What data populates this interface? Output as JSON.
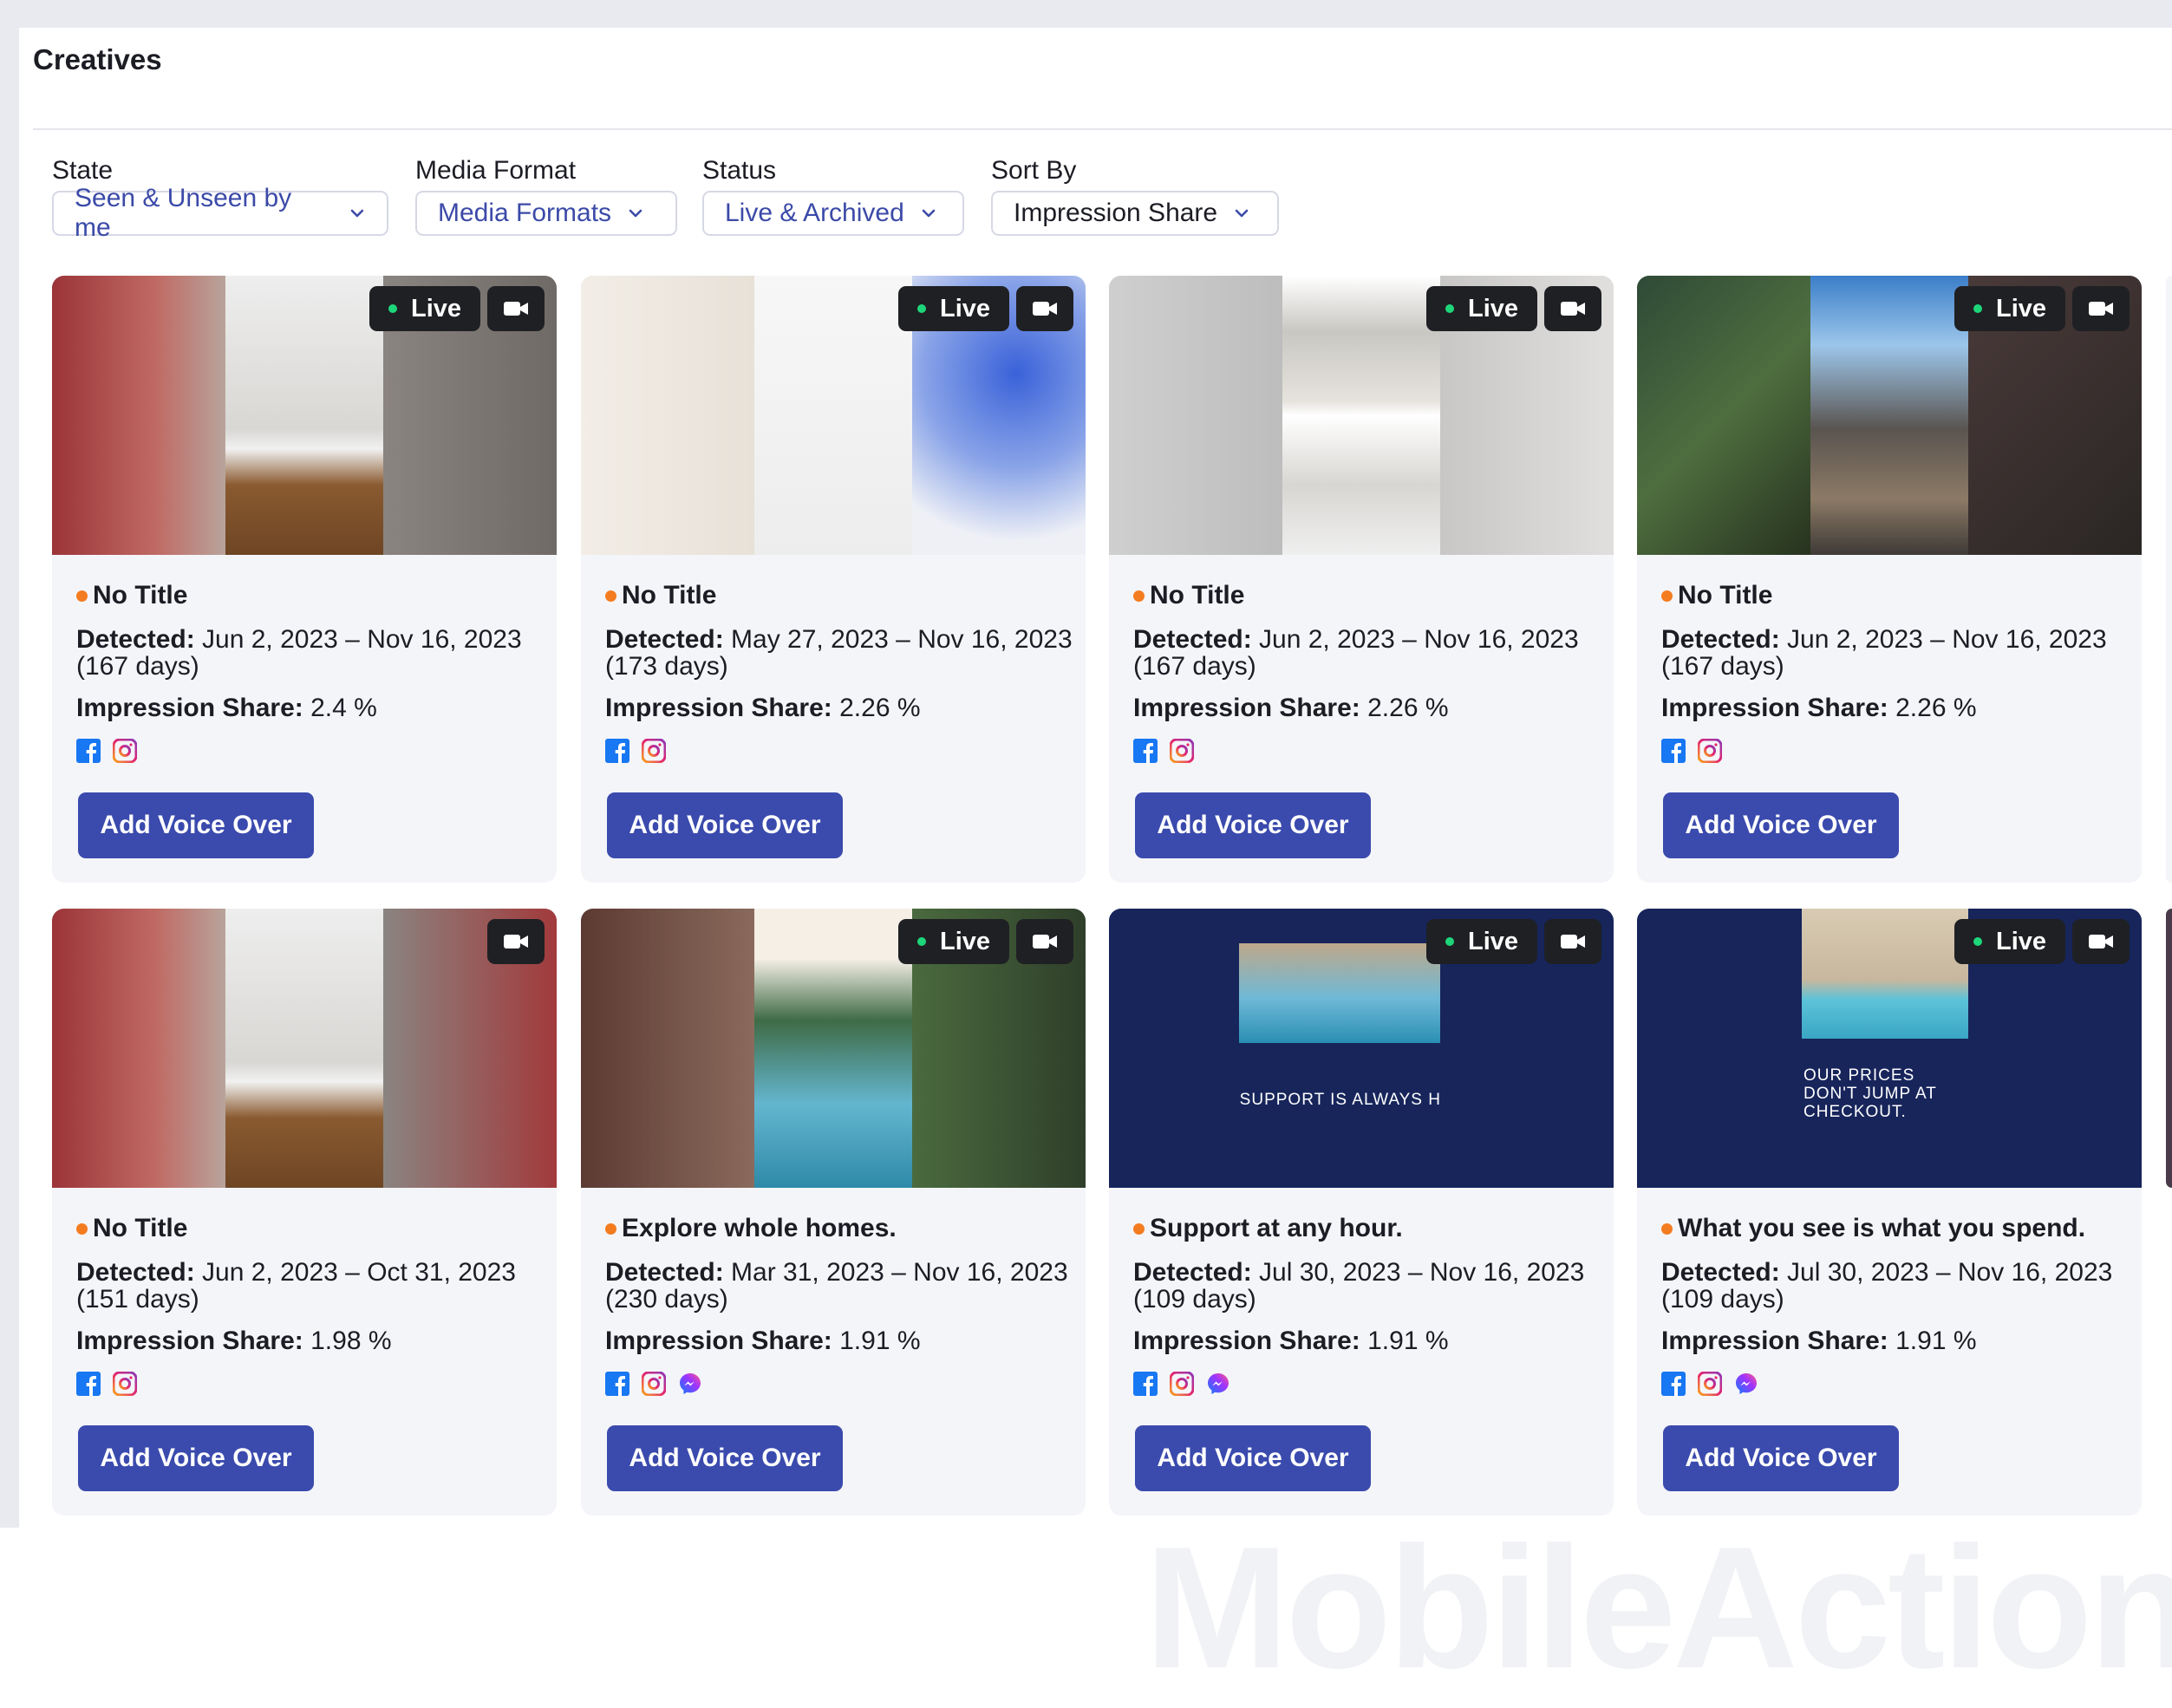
{
  "section": {
    "title": "Creatives"
  },
  "filters": [
    {
      "label": "State",
      "value": "Seen & Unseen by me"
    },
    {
      "label": "Media Format",
      "value": "Media Formats"
    },
    {
      "label": "Status",
      "value": "Live & Archived"
    },
    {
      "label": "Sort By",
      "value": "Impression Share"
    }
  ],
  "cards": [
    {
      "title": "No Title",
      "detected_label": "Detected:",
      "detected": "Jun 2, 2023 – Nov 16, 2023 (167 days)",
      "share_label": "Impression Share:",
      "share": "2.4 %",
      "live_label": "Live",
      "platforms": [
        "facebook-icon",
        "instagram-icon"
      ],
      "button": "Add Voice Over"
    },
    {
      "title": "No Title",
      "detected_label": "Detected:",
      "detected": "May 27, 2023 – Nov 16, 2023 (173 days)",
      "share_label": "Impression Share:",
      "share": "2.26 %",
      "live_label": "Live",
      "platforms": [
        "facebook-icon",
        "instagram-icon"
      ],
      "button": "Add Voice Over"
    },
    {
      "title": "No Title",
      "detected_label": "Detected:",
      "detected": "Jun 2, 2023 – Nov 16, 2023 (167 days)",
      "share_label": "Impression Share:",
      "share": "2.26 %",
      "live_label": "Live",
      "platforms": [
        "facebook-icon",
        "instagram-icon"
      ],
      "button": "Add Voice Over"
    },
    {
      "title": "No Title",
      "detected_label": "Detected:",
      "detected": "Jun 2, 2023 – Nov 16, 2023 (167 days)",
      "share_label": "Impression Share:",
      "share": "2.26 %",
      "live_label": "Live",
      "platforms": [
        "facebook-icon",
        "instagram-icon"
      ],
      "button": "Add Voice Over"
    },
    {
      "title": "No Title",
      "detected_label": "Detected:",
      "detected": "Jun 2, 2023 – Oct 31, 2023 (151 days)",
      "share_label": "Impression Share:",
      "share": "1.98 %",
      "live_label": "",
      "platforms": [
        "facebook-icon",
        "instagram-icon"
      ],
      "button": "Add Voice Over"
    },
    {
      "title": "Explore whole homes.",
      "detected_label": "Detected:",
      "detected": "Mar 31, 2023 – Nov 16, 2023 (230 days)",
      "share_label": "Impression Share:",
      "share": "1.91 %",
      "live_label": "Live",
      "platforms": [
        "facebook-icon",
        "instagram-icon",
        "messenger-icon"
      ],
      "button": "Add Voice Over"
    },
    {
      "title": "Support at any hour.",
      "detected_label": "Detected:",
      "detected": "Jul 30, 2023 – Nov 16, 2023 (109 days)",
      "share_label": "Impression Share:",
      "share": "1.91 %",
      "live_label": "Live",
      "platforms": [
        "facebook-icon",
        "instagram-icon",
        "messenger-icon"
      ],
      "button": "Add Voice Over",
      "overlay_text": "SUPPORT IS ALWAYS HERE."
    },
    {
      "title": "What you see is what you spend.",
      "detected_label": "Detected:",
      "detected": "Jul 30, 2023 – Nov 16, 2023 (109 days)",
      "share_label": "Impression Share:",
      "share": "1.91 %",
      "live_label": "Live",
      "platforms": [
        "facebook-icon",
        "instagram-icon",
        "messenger-icon"
      ],
      "button": "Add Voice Over",
      "overlay_text": "OUR PRICES DON'T JUMP AT CHECKOUT."
    }
  ],
  "colors": {
    "accent": "#3a4aad",
    "link": "#3b4aa8",
    "live_dot": "#1ed67a",
    "status_dot": "#f47c20",
    "card_bg": "#f4f5f9"
  },
  "watermark": "MobileAction"
}
